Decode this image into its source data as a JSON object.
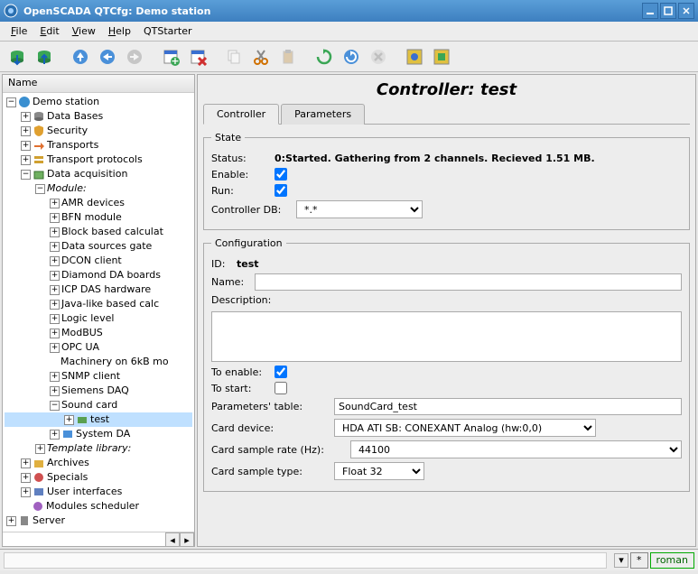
{
  "window": {
    "title": "OpenSCADA QTCfg: Demo station"
  },
  "menu": {
    "file": "File",
    "edit": "Edit",
    "view": "View",
    "help": "Help",
    "qtstarter": "QTStarter"
  },
  "tree": {
    "header": "Name",
    "root": "Demo station",
    "databases": "Data Bases",
    "security": "Security",
    "transports": "Transports",
    "transport_protocols": "Transport protocols",
    "data_acquisition": "Data acquisition",
    "module": "Module:",
    "amr": "AMR devices",
    "bfn": "BFN module",
    "block": "Block based calculat",
    "dsg": "Data sources gate",
    "dcon": "DCON client",
    "diamond": "Diamond DA boards",
    "icp": "ICP DAS hardware",
    "java": "Java-like based calc",
    "logic": "Logic level",
    "modbus": "ModBUS",
    "opcua": "OPC UA",
    "machinery": "Machinery on 6kB mo",
    "snmp": "SNMP client",
    "siemens": "Siemens DAQ",
    "soundcard": "Sound card",
    "test": "test",
    "systemda": "System DA",
    "template_lib": "Template library:",
    "archives": "Archives",
    "specials": "Specials",
    "ui": "User interfaces",
    "modules_sched": "Modules scheduler",
    "server": "Server"
  },
  "page": {
    "title": "Controller: test",
    "tab_controller": "Controller",
    "tab_parameters": "Parameters"
  },
  "state": {
    "legend": "State",
    "status_label": "Status:",
    "status_value": "0:Started. Gathering from 2 channels. Recieved 1.51 MB.",
    "enable_label": "Enable:",
    "run_label": "Run:",
    "controller_db_label": "Controller DB:",
    "controller_db_value": "*.*"
  },
  "config": {
    "legend": "Configuration",
    "id_label": "ID:",
    "id_value": "test",
    "name_label": "Name:",
    "name_value": "",
    "desc_label": "Description:",
    "desc_value": "",
    "to_enable_label": "To enable:",
    "to_start_label": "To start:",
    "params_table_label": "Parameters' table:",
    "params_table_value": "SoundCard_test",
    "card_device_label": "Card device:",
    "card_device_value": "HDA ATI SB: CONEXANT Analog (hw:0,0)",
    "sample_rate_label": "Card sample rate (Hz):",
    "sample_rate_value": "44100",
    "sample_type_label": "Card sample type:",
    "sample_type_value": "Float 32"
  },
  "status": {
    "marker": "*",
    "user": "roman"
  }
}
